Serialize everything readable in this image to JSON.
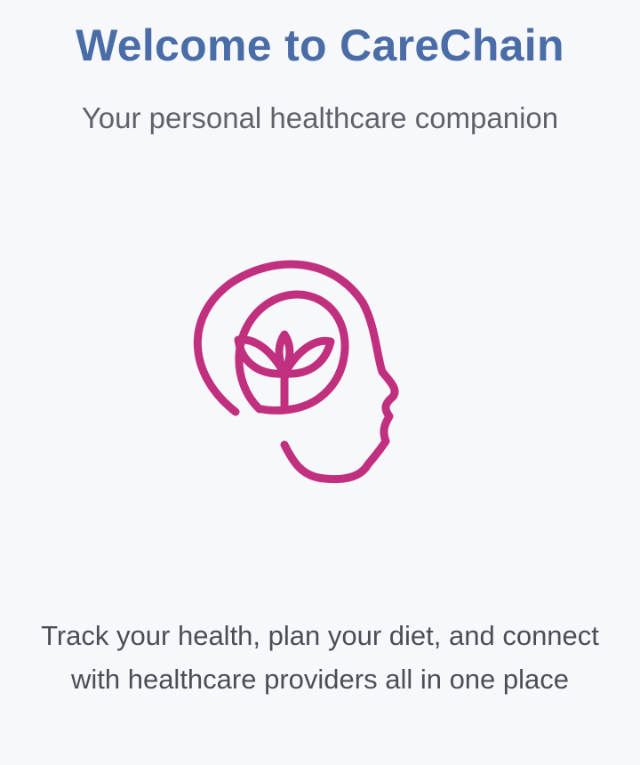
{
  "welcome": {
    "title": "Welcome to CareChain",
    "subtitle": "Your personal healthcare companion",
    "description": "Track your health, plan your diet, and connect with healthcare providers all in one place"
  },
  "illustration": {
    "icon": "head-with-sprout-icon",
    "color": "#c0307f"
  },
  "colors": {
    "title": "#4a6da7",
    "subtitle": "#5f6368",
    "background": "#f7f8fb"
  }
}
